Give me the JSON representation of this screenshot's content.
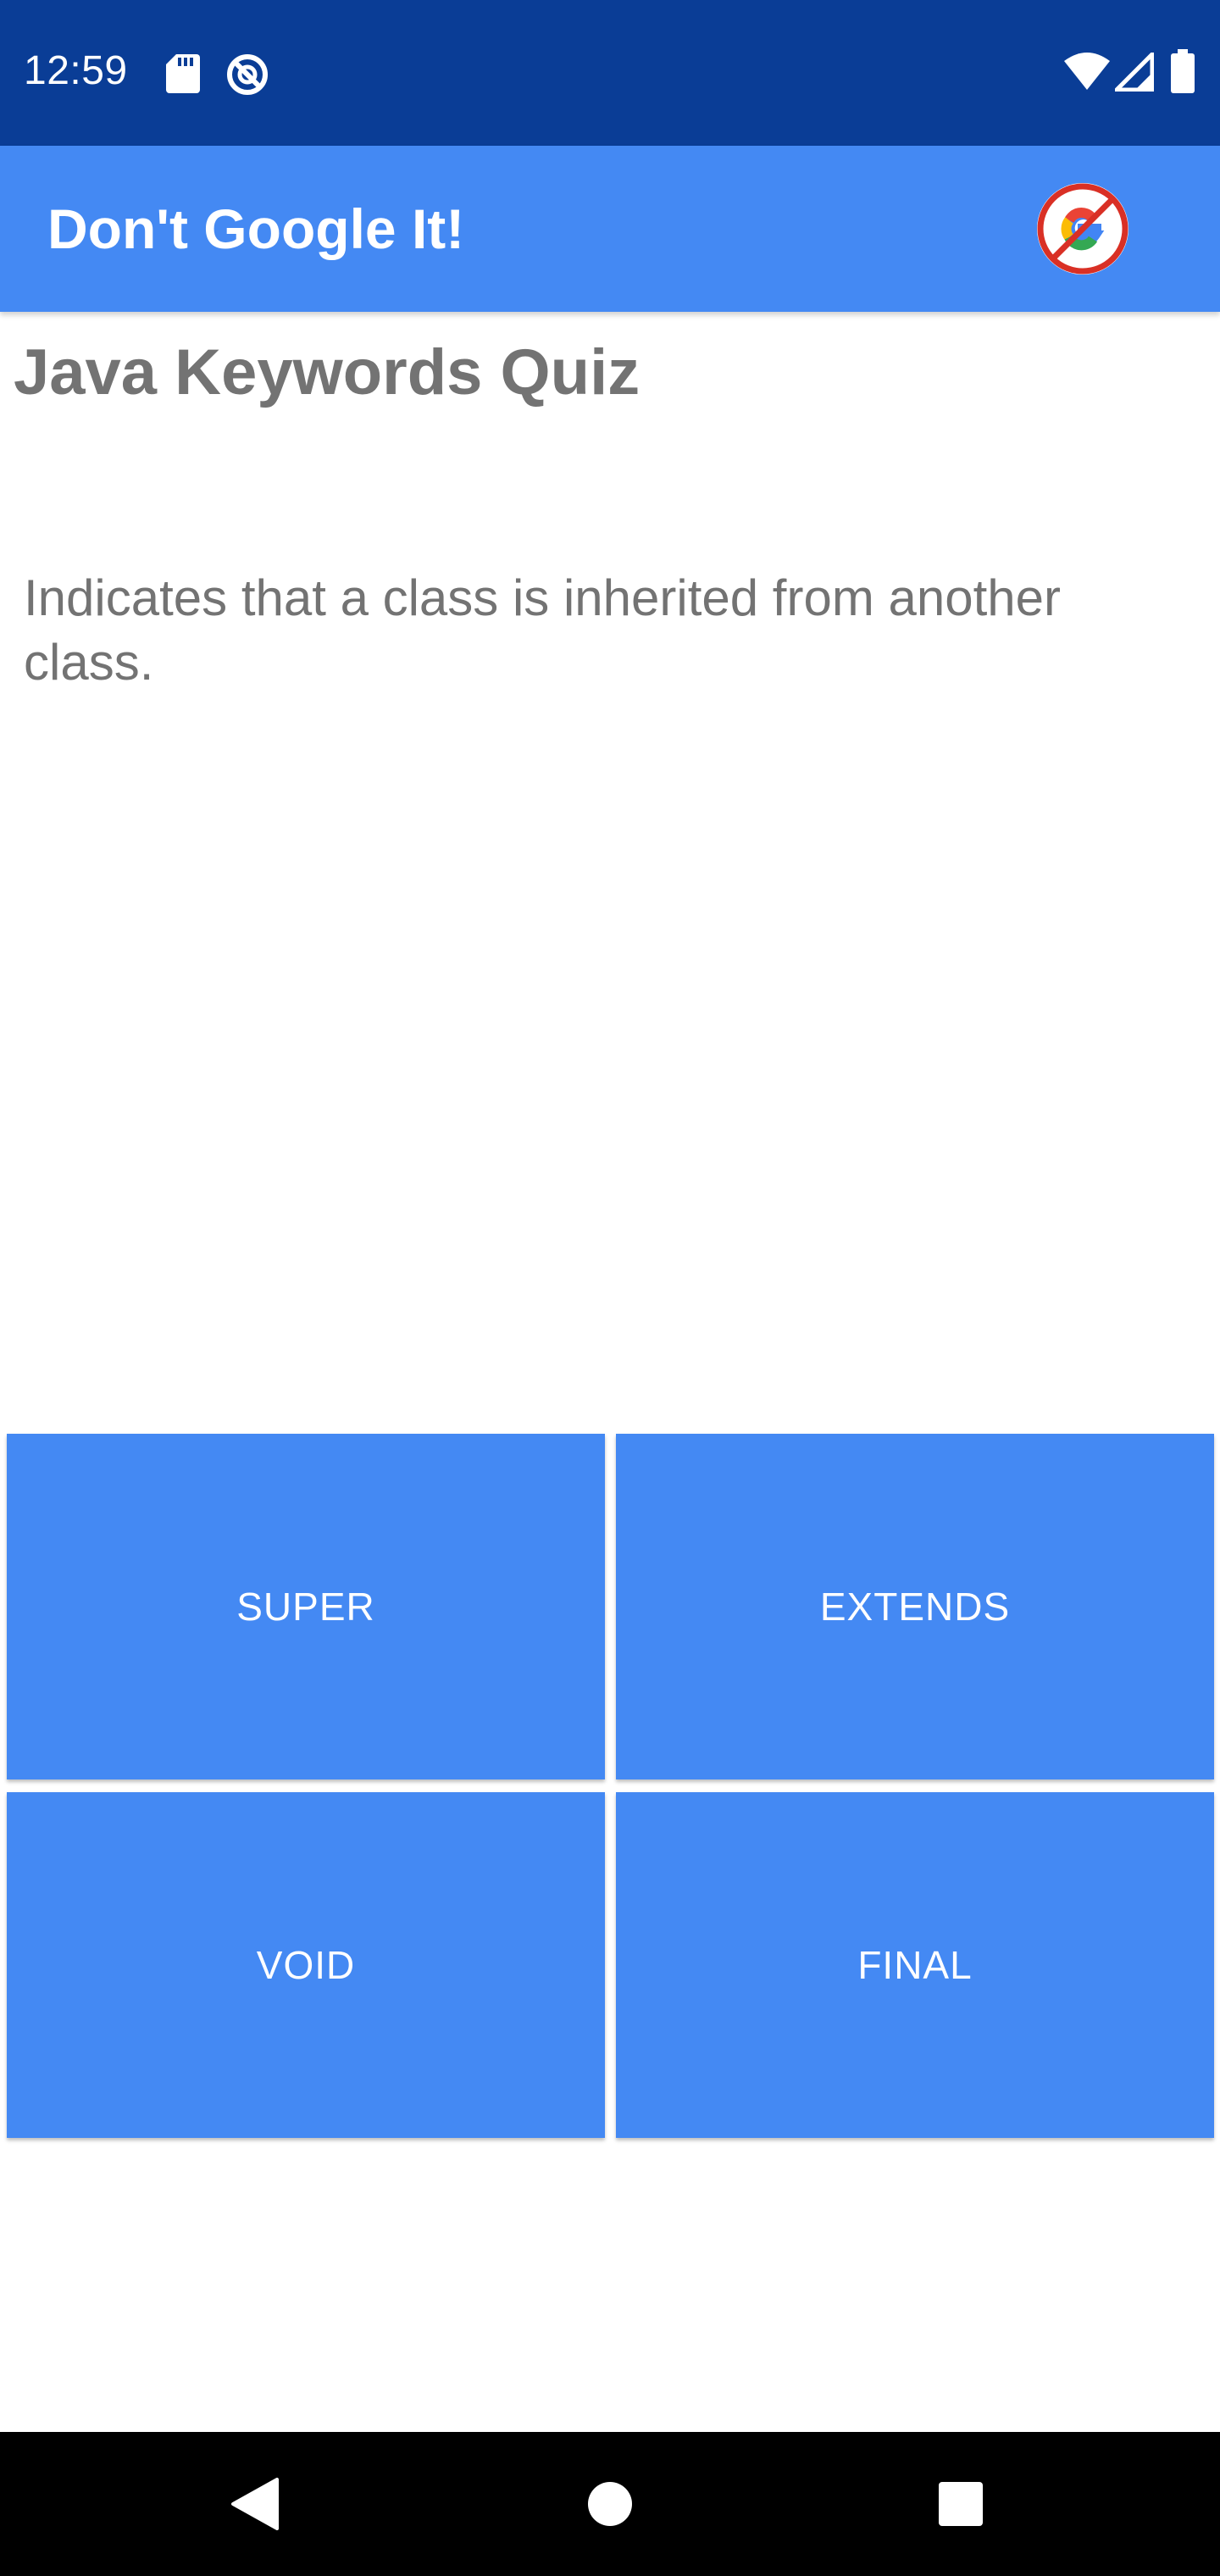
{
  "status_bar": {
    "time": "12:59",
    "background_color": "#0a3d96",
    "left_icons": [
      "sd-card-icon",
      "do-not-disturb-icon"
    ],
    "right_icons": [
      "wifi-icon",
      "cell-signal-icon",
      "battery-icon"
    ]
  },
  "app_bar": {
    "title": "Don't Google It!",
    "background_color": "#4489f3",
    "logo_icon": "no-google-logo-icon"
  },
  "quiz": {
    "title": "Java Keywords Quiz",
    "question": "Indicates that a class is inherited from another class.",
    "answers": [
      {
        "label": "SUPER"
      },
      {
        "label": "EXTENDS"
      },
      {
        "label": "VOID"
      },
      {
        "label": "FINAL"
      }
    ],
    "button_color": "#4489f3"
  },
  "nav_bar": {
    "buttons": [
      "back-icon",
      "home-icon",
      "recents-icon"
    ]
  }
}
